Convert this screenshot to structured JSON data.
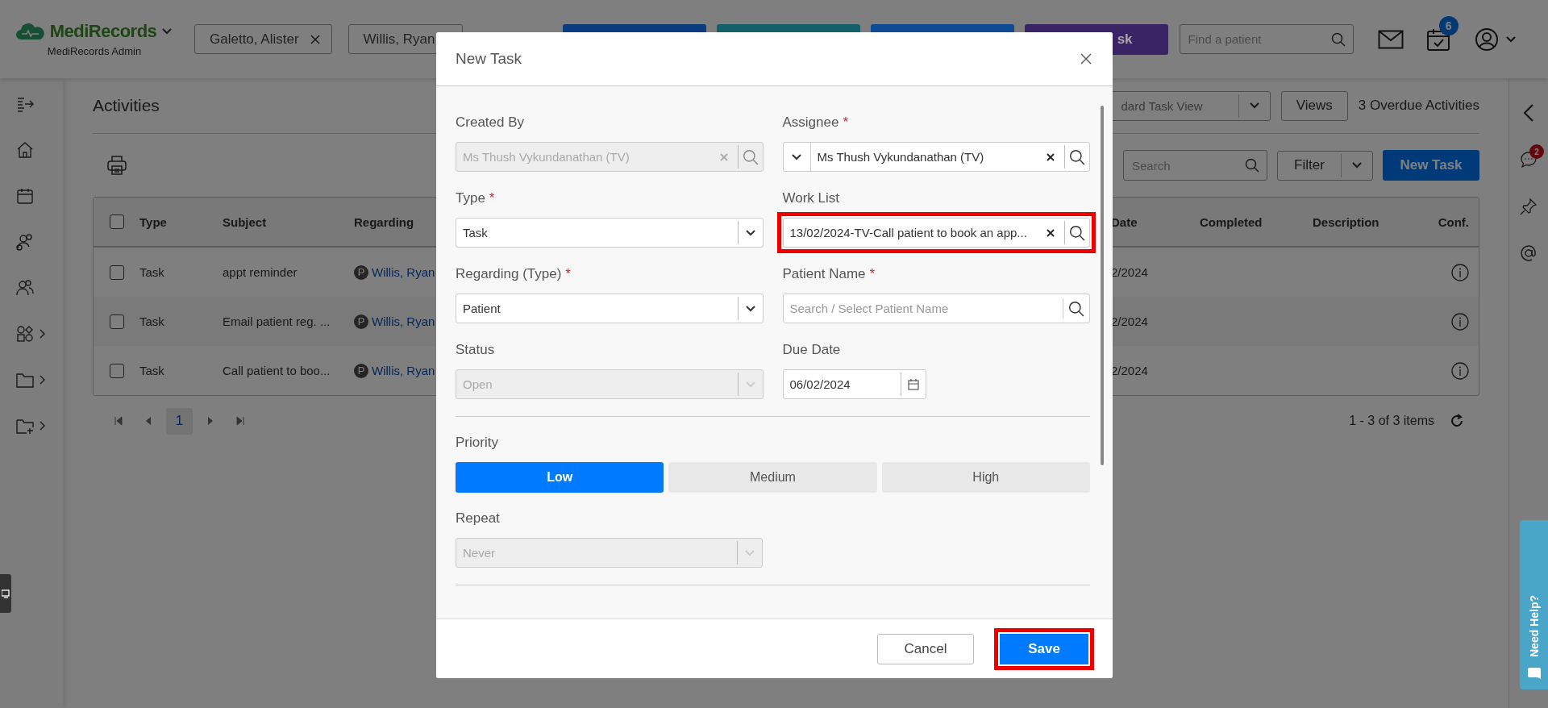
{
  "app": {
    "logo": "MediRecords",
    "subtitle": "MediRecords Admin"
  },
  "patient_tabs": [
    {
      "name": "Galetto, Alister",
      "closable": true
    },
    {
      "name": "Willis, Ryan",
      "closable": false
    }
  ],
  "header_buttons": [
    {
      "color": "#0b3c80"
    },
    {
      "color": "#14606a"
    },
    {
      "color": "#0e4b94"
    },
    {
      "color": "#3a2466",
      "label": "sk"
    }
  ],
  "patient_search": {
    "placeholder": "Find a patient"
  },
  "tasks_badge": "6",
  "sidebar": [
    {
      "kind": "collapse",
      "expandable": false
    },
    {
      "kind": "home",
      "expandable": false
    },
    {
      "kind": "calendar",
      "expandable": false
    },
    {
      "kind": "contacts",
      "expandable": false
    },
    {
      "kind": "people",
      "expandable": false
    },
    {
      "kind": "apps",
      "expandable": true
    },
    {
      "kind": "folder",
      "expandable": true
    },
    {
      "kind": "folder-add",
      "expandable": true
    }
  ],
  "page": {
    "title": "Activities",
    "view_select": "dard Task View",
    "views_button": "Views",
    "overdue": "3 Overdue Activities",
    "search_placeholder": "Search",
    "filter": "Filter",
    "new_task": "New Task"
  },
  "table": {
    "select_all_checked": false,
    "columns_left": [
      "Type",
      "Subject",
      "Regarding"
    ],
    "columns_right": [
      "Date",
      "Completed",
      "Description",
      "Conf."
    ],
    "rows": [
      {
        "checked": false,
        "type": "Task",
        "subject": "appt reminder",
        "regarding_badge": "P",
        "regarding": "Willis, Ryan",
        "date": "2/2024"
      },
      {
        "checked": false,
        "type": "Task",
        "subject": "Email patient reg. ...",
        "regarding_badge": "P",
        "regarding": "Willis, Ryan",
        "date": "2/2024"
      },
      {
        "checked": false,
        "type": "Task",
        "subject": "Call patient to boo...",
        "regarding_badge": "P",
        "regarding": "Willis, Ryan",
        "date": "2/2024"
      }
    ]
  },
  "pagination": {
    "pages": [
      {
        "label": "1",
        "selected": true
      }
    ],
    "summary": "1 - 3 of 3 items"
  },
  "right_rail": {
    "chat_badge": "2"
  },
  "help_tab": "Need Help?",
  "modal": {
    "title": "New Task",
    "fields": [
      {
        "label": "Created By",
        "kind": "lookup",
        "value": "Ms Thush Vykundanathan (TV)",
        "disabled": true,
        "highlighted": false,
        "prefix_dropdown": false
      },
      {
        "label": "Assignee",
        "required_mark": "*",
        "kind": "lookup",
        "value": "Ms Thush Vykundanathan (TV)",
        "disabled": false,
        "highlighted": false,
        "prefix_dropdown": true
      },
      {
        "label": "Type",
        "required_mark": "*",
        "kind": "select",
        "value": "Task",
        "disabled": false,
        "highlighted": false
      },
      {
        "label": "Work List",
        "kind": "lookup",
        "value": "13/02/2024-TV-Call patient to book an app...",
        "disabled": false,
        "highlighted": true,
        "prefix_dropdown": false
      },
      {
        "label": "Regarding (Type)",
        "required_mark": "*",
        "kind": "select",
        "value": "Patient",
        "disabled": false,
        "highlighted": false
      },
      {
        "label": "Patient Name",
        "required_mark": "*",
        "kind": "search",
        "placeholder": "Search / Select Patient Name",
        "disabled": false,
        "highlighted": false
      },
      {
        "label": "Status",
        "kind": "select",
        "value": "Open",
        "disabled": true,
        "highlighted": false
      },
      {
        "label": "Due Date",
        "kind": "date",
        "value": "06/02/2024",
        "disabled": false,
        "highlighted": false
      }
    ],
    "priority": {
      "label": "Priority",
      "options": [
        {
          "label": "Low",
          "selected": true
        },
        {
          "label": "Medium",
          "selected": false
        },
        {
          "label": "High",
          "selected": false
        }
      ]
    },
    "repeat": {
      "label": "Repeat",
      "value": "Never",
      "disabled": true
    },
    "cancel": "Cancel",
    "save": {
      "label": "Save",
      "highlighted": true
    }
  }
}
